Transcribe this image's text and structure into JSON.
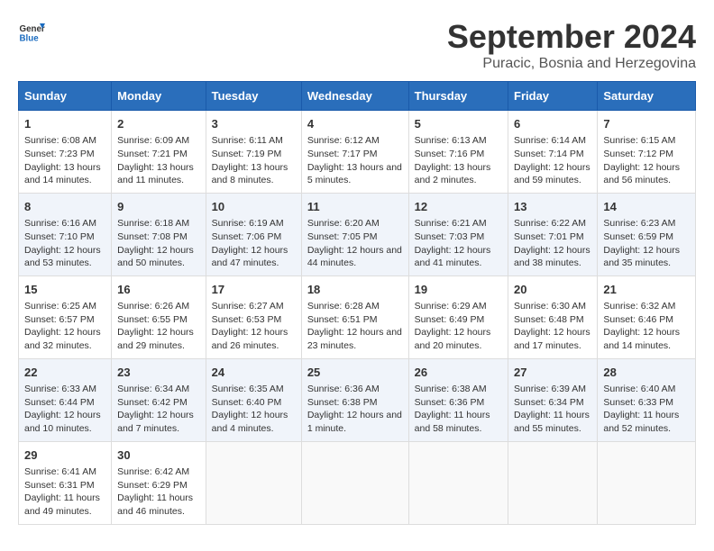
{
  "header": {
    "logo_line1": "General",
    "logo_line2": "Blue",
    "title": "September 2024",
    "subtitle": "Puracic, Bosnia and Herzegovina"
  },
  "days_of_week": [
    "Sunday",
    "Monday",
    "Tuesday",
    "Wednesday",
    "Thursday",
    "Friday",
    "Saturday"
  ],
  "weeks": [
    [
      {
        "day": "1",
        "sunrise": "Sunrise: 6:08 AM",
        "sunset": "Sunset: 7:23 PM",
        "daylight": "Daylight: 13 hours and 14 minutes."
      },
      {
        "day": "2",
        "sunrise": "Sunrise: 6:09 AM",
        "sunset": "Sunset: 7:21 PM",
        "daylight": "Daylight: 13 hours and 11 minutes."
      },
      {
        "day": "3",
        "sunrise": "Sunrise: 6:11 AM",
        "sunset": "Sunset: 7:19 PM",
        "daylight": "Daylight: 13 hours and 8 minutes."
      },
      {
        "day": "4",
        "sunrise": "Sunrise: 6:12 AM",
        "sunset": "Sunset: 7:17 PM",
        "daylight": "Daylight: 13 hours and 5 minutes."
      },
      {
        "day": "5",
        "sunrise": "Sunrise: 6:13 AM",
        "sunset": "Sunset: 7:16 PM",
        "daylight": "Daylight: 13 hours and 2 minutes."
      },
      {
        "day": "6",
        "sunrise": "Sunrise: 6:14 AM",
        "sunset": "Sunset: 7:14 PM",
        "daylight": "Daylight: 12 hours and 59 minutes."
      },
      {
        "day": "7",
        "sunrise": "Sunrise: 6:15 AM",
        "sunset": "Sunset: 7:12 PM",
        "daylight": "Daylight: 12 hours and 56 minutes."
      }
    ],
    [
      {
        "day": "8",
        "sunrise": "Sunrise: 6:16 AM",
        "sunset": "Sunset: 7:10 PM",
        "daylight": "Daylight: 12 hours and 53 minutes."
      },
      {
        "day": "9",
        "sunrise": "Sunrise: 6:18 AM",
        "sunset": "Sunset: 7:08 PM",
        "daylight": "Daylight: 12 hours and 50 minutes."
      },
      {
        "day": "10",
        "sunrise": "Sunrise: 6:19 AM",
        "sunset": "Sunset: 7:06 PM",
        "daylight": "Daylight: 12 hours and 47 minutes."
      },
      {
        "day": "11",
        "sunrise": "Sunrise: 6:20 AM",
        "sunset": "Sunset: 7:05 PM",
        "daylight": "Daylight: 12 hours and 44 minutes."
      },
      {
        "day": "12",
        "sunrise": "Sunrise: 6:21 AM",
        "sunset": "Sunset: 7:03 PM",
        "daylight": "Daylight: 12 hours and 41 minutes."
      },
      {
        "day": "13",
        "sunrise": "Sunrise: 6:22 AM",
        "sunset": "Sunset: 7:01 PM",
        "daylight": "Daylight: 12 hours and 38 minutes."
      },
      {
        "day": "14",
        "sunrise": "Sunrise: 6:23 AM",
        "sunset": "Sunset: 6:59 PM",
        "daylight": "Daylight: 12 hours and 35 minutes."
      }
    ],
    [
      {
        "day": "15",
        "sunrise": "Sunrise: 6:25 AM",
        "sunset": "Sunset: 6:57 PM",
        "daylight": "Daylight: 12 hours and 32 minutes."
      },
      {
        "day": "16",
        "sunrise": "Sunrise: 6:26 AM",
        "sunset": "Sunset: 6:55 PM",
        "daylight": "Daylight: 12 hours and 29 minutes."
      },
      {
        "day": "17",
        "sunrise": "Sunrise: 6:27 AM",
        "sunset": "Sunset: 6:53 PM",
        "daylight": "Daylight: 12 hours and 26 minutes."
      },
      {
        "day": "18",
        "sunrise": "Sunrise: 6:28 AM",
        "sunset": "Sunset: 6:51 PM",
        "daylight": "Daylight: 12 hours and 23 minutes."
      },
      {
        "day": "19",
        "sunrise": "Sunrise: 6:29 AM",
        "sunset": "Sunset: 6:49 PM",
        "daylight": "Daylight: 12 hours and 20 minutes."
      },
      {
        "day": "20",
        "sunrise": "Sunrise: 6:30 AM",
        "sunset": "Sunset: 6:48 PM",
        "daylight": "Daylight: 12 hours and 17 minutes."
      },
      {
        "day": "21",
        "sunrise": "Sunrise: 6:32 AM",
        "sunset": "Sunset: 6:46 PM",
        "daylight": "Daylight: 12 hours and 14 minutes."
      }
    ],
    [
      {
        "day": "22",
        "sunrise": "Sunrise: 6:33 AM",
        "sunset": "Sunset: 6:44 PM",
        "daylight": "Daylight: 12 hours and 10 minutes."
      },
      {
        "day": "23",
        "sunrise": "Sunrise: 6:34 AM",
        "sunset": "Sunset: 6:42 PM",
        "daylight": "Daylight: 12 hours and 7 minutes."
      },
      {
        "day": "24",
        "sunrise": "Sunrise: 6:35 AM",
        "sunset": "Sunset: 6:40 PM",
        "daylight": "Daylight: 12 hours and 4 minutes."
      },
      {
        "day": "25",
        "sunrise": "Sunrise: 6:36 AM",
        "sunset": "Sunset: 6:38 PM",
        "daylight": "Daylight: 12 hours and 1 minute."
      },
      {
        "day": "26",
        "sunrise": "Sunrise: 6:38 AM",
        "sunset": "Sunset: 6:36 PM",
        "daylight": "Daylight: 11 hours and 58 minutes."
      },
      {
        "day": "27",
        "sunrise": "Sunrise: 6:39 AM",
        "sunset": "Sunset: 6:34 PM",
        "daylight": "Daylight: 11 hours and 55 minutes."
      },
      {
        "day": "28",
        "sunrise": "Sunrise: 6:40 AM",
        "sunset": "Sunset: 6:33 PM",
        "daylight": "Daylight: 11 hours and 52 minutes."
      }
    ],
    [
      {
        "day": "29",
        "sunrise": "Sunrise: 6:41 AM",
        "sunset": "Sunset: 6:31 PM",
        "daylight": "Daylight: 11 hours and 49 minutes."
      },
      {
        "day": "30",
        "sunrise": "Sunrise: 6:42 AM",
        "sunset": "Sunset: 6:29 PM",
        "daylight": "Daylight: 11 hours and 46 minutes."
      },
      null,
      null,
      null,
      null,
      null
    ]
  ]
}
